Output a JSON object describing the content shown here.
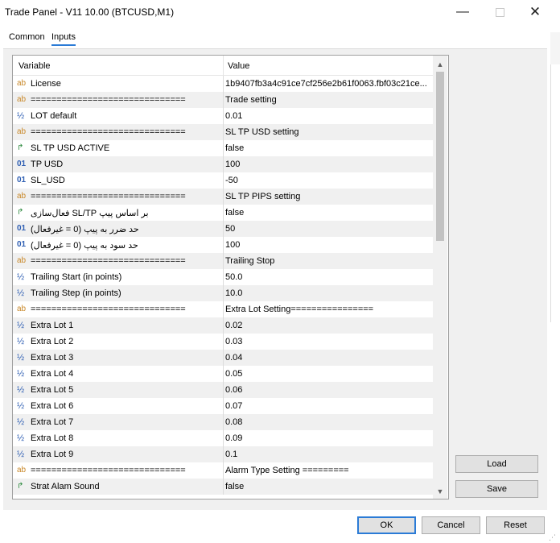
{
  "window": {
    "title": "Trade Panel - V11 10.00 (BTCUSD,M1)",
    "minimize_glyph": "—",
    "close_glyph": "✕"
  },
  "tabs": [
    {
      "label": "Common"
    },
    {
      "label": "Inputs",
      "active": true
    }
  ],
  "grid": {
    "header": {
      "variable": "Variable",
      "value": "Value"
    },
    "rows": [
      {
        "icon": "ab",
        "variable": "License",
        "value": "1b9407fb3a4c91ce7cf256e2b61f0063.fbf03c21ce..."
      },
      {
        "icon": "ab",
        "variable": "==============================",
        "value": "Trade setting"
      },
      {
        "icon": "½",
        "variable": "LOT default",
        "value": "0.01"
      },
      {
        "icon": "ab",
        "variable": "==============================",
        "value": "SL TP USD setting"
      },
      {
        "icon": "↱",
        "variable": "SL TP USD ACTIVE",
        "value": "false"
      },
      {
        "icon": "01",
        "variable": "TP USD",
        "value": "100"
      },
      {
        "icon": "01",
        "variable": "SL_USD",
        "value": "-50"
      },
      {
        "icon": "ab",
        "variable": "==============================",
        "value": "SL TP PIPS setting"
      },
      {
        "icon": "↱",
        "variable": "بر اساس پیپ SL/TP فعال‌سازی",
        "value": "false"
      },
      {
        "icon": "01",
        "variable": "حد ضرر به پیپ (0 = غیرفعال)",
        "value": "50"
      },
      {
        "icon": "01",
        "variable": "حد سود به پیپ (0 = غیرفعال)",
        "value": "100"
      },
      {
        "icon": "ab",
        "variable": "==============================",
        "value": "Trailing Stop"
      },
      {
        "icon": "½",
        "variable": "Trailing Start (in points)",
        "value": "50.0"
      },
      {
        "icon": "½",
        "variable": "Trailing Step (in points)",
        "value": "10.0"
      },
      {
        "icon": "ab",
        "variable": "==============================",
        "value": "Extra Lot Setting================"
      },
      {
        "icon": "½",
        "variable": "Extra Lot 1",
        "value": "0.02"
      },
      {
        "icon": "½",
        "variable": "Extra Lot 2",
        "value": "0.03"
      },
      {
        "icon": "½",
        "variable": "Extra Lot 3",
        "value": "0.04"
      },
      {
        "icon": "½",
        "variable": "Extra Lot 4",
        "value": "0.05"
      },
      {
        "icon": "½",
        "variable": "Extra Lot 5",
        "value": "0.06"
      },
      {
        "icon": "½",
        "variable": "Extra Lot 6",
        "value": "0.07"
      },
      {
        "icon": "½",
        "variable": "Extra Lot 7",
        "value": "0.08"
      },
      {
        "icon": "½",
        "variable": "Extra Lot 8",
        "value": "0.09"
      },
      {
        "icon": "½",
        "variable": "Extra Lot 9",
        "value": "0.1"
      },
      {
        "icon": "ab",
        "variable": "==============================",
        "value": "Alarm Type Setting ========="
      },
      {
        "icon": "↱",
        "variable": "Strat Alam Sound",
        "value": "false"
      }
    ]
  },
  "side_buttons": {
    "load": "Load",
    "save": "Save"
  },
  "footer_buttons": {
    "ok": "OK",
    "cancel": "Cancel",
    "reset": "Reset"
  },
  "colors": {
    "accent": "#2b7bd6",
    "string_icon": "#c9892b",
    "number_icon": "#2f5fb3",
    "bool_icon": "#2d8a3e"
  }
}
